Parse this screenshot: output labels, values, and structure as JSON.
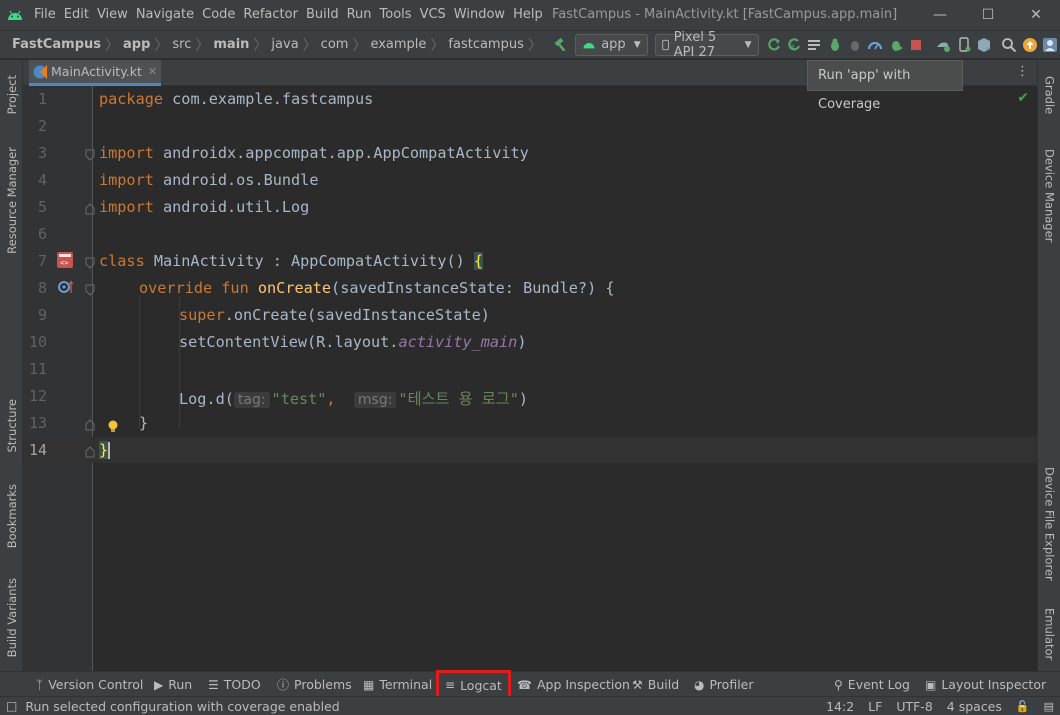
{
  "menu": [
    "File",
    "Edit",
    "View",
    "Navigate",
    "Code",
    "Refactor",
    "Build",
    "Run",
    "Tools",
    "VCS",
    "Window",
    "Help"
  ],
  "window_title": "FastCampus - MainActivity.kt [FastCampus.app.main]",
  "breadcrumb": [
    "FastCampus",
    "app",
    "src",
    "main",
    "java",
    "com",
    "example",
    "fastcampus"
  ],
  "toolbar": {
    "config": "app",
    "device": "Pixel 5 API 27"
  },
  "tooltip": "Run 'app' with Coverage",
  "left_tabs": [
    "Project",
    "Resource Manager",
    "Structure",
    "Bookmarks",
    "Build Variants"
  ],
  "right_tabs": [
    "Gradle",
    "Device Manager",
    "Device File Explorer",
    "Emulator"
  ],
  "editor": {
    "tab_name": "MainActivity.kt",
    "lines": [
      {
        "no": "1"
      },
      {
        "no": "2"
      },
      {
        "no": "3"
      },
      {
        "no": "4"
      },
      {
        "no": "5"
      },
      {
        "no": "6"
      },
      {
        "no": "7"
      },
      {
        "no": "8"
      },
      {
        "no": "9"
      },
      {
        "no": "10"
      },
      {
        "no": "11"
      },
      {
        "no": "12"
      },
      {
        "no": "13"
      },
      {
        "no": "14"
      }
    ],
    "code": {
      "l1_kw": "package",
      "l1_rest": " com.example.fastcampus",
      "l3_kw": "import",
      "l3_rest": " androidx.appcompat.app.AppCompatActivity",
      "l4_kw": "import",
      "l4_rest": " android.os.Bundle",
      "l5_kw": "import",
      "l5_rest": " android.util.Log",
      "l7_kw": "class",
      "l7_rest": " MainActivity : AppCompatActivity() ",
      "l7_brace": "{",
      "l8_kw": "override fun",
      "l8_fn": "onCreate",
      "l8_rest": "(savedInstanceState: Bundle?) {",
      "l9_kw": "super",
      "l9_rest": ".onCreate(savedInstanceState)",
      "l10_a": "setContentView(R.layout.",
      "l10_b": "activity_main",
      "l10_c": ")",
      "l12_a": "Log.d(",
      "l12_hint1": "tag:",
      "l12_str1": "\"test\"",
      "l12_comma": ", ",
      "l12_hint2": "msg:",
      "l12_str2": "\"테스트 용 로그\"",
      "l12_c": ")",
      "l13": "}",
      "l14": "}"
    }
  },
  "bottom_tools": {
    "version_control": "Version Control",
    "run": "Run",
    "todo": "TODO",
    "problems": "Problems",
    "terminal": "Terminal",
    "logcat": "Logcat",
    "app_inspection": "App Inspection",
    "build": "Build",
    "profiler": "Profiler",
    "event_log": "Event Log",
    "layout_inspector": "Layout Inspector"
  },
  "status": {
    "message": "Run selected configuration with coverage enabled",
    "position": "14:2",
    "line_sep": "LF",
    "encoding": "UTF-8",
    "indent": "4 spaces"
  },
  "colors": {
    "accent": "#4a88c7",
    "highlight_box": "#e01c1c",
    "keyword": "#cc7832",
    "function": "#ffc66d",
    "string": "#6a8759"
  }
}
